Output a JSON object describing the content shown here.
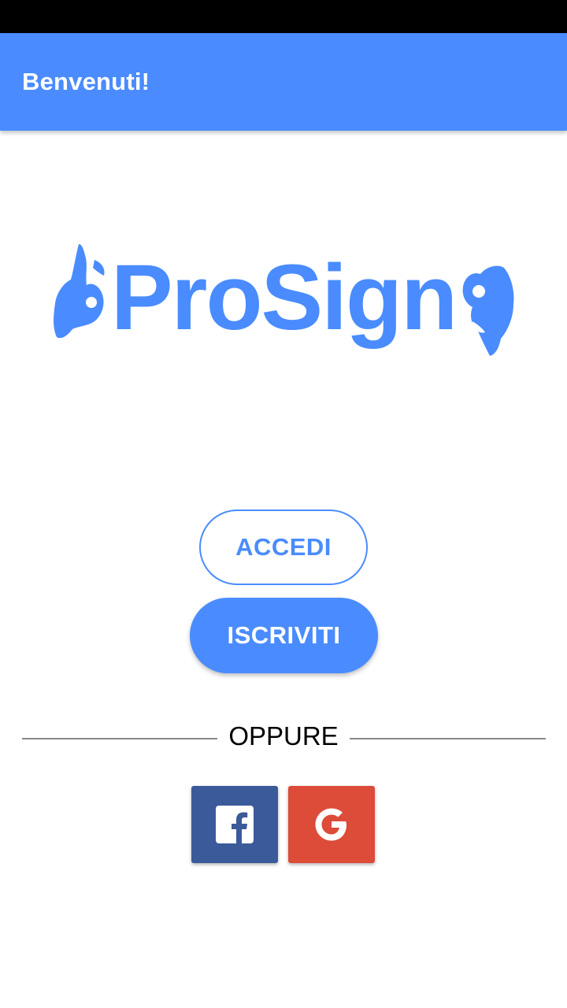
{
  "app_bar": {
    "title": "Benvenuti!"
  },
  "logo": {
    "text": "ProSign",
    "icons": [
      "ok-hand-sign-icon",
      "ok-hand-sign-icon"
    ]
  },
  "buttons": {
    "login_label": "ACCEDI",
    "signup_label": "ISCRIVITI"
  },
  "divider": {
    "label": "OPPURE"
  },
  "social": {
    "facebook_icon": "facebook-icon",
    "google_icon": "google-icon"
  },
  "colors": {
    "primary": "#4a8cff",
    "facebook": "#3b5a9a",
    "google": "#dd4b39",
    "status_bar": "#000000"
  }
}
